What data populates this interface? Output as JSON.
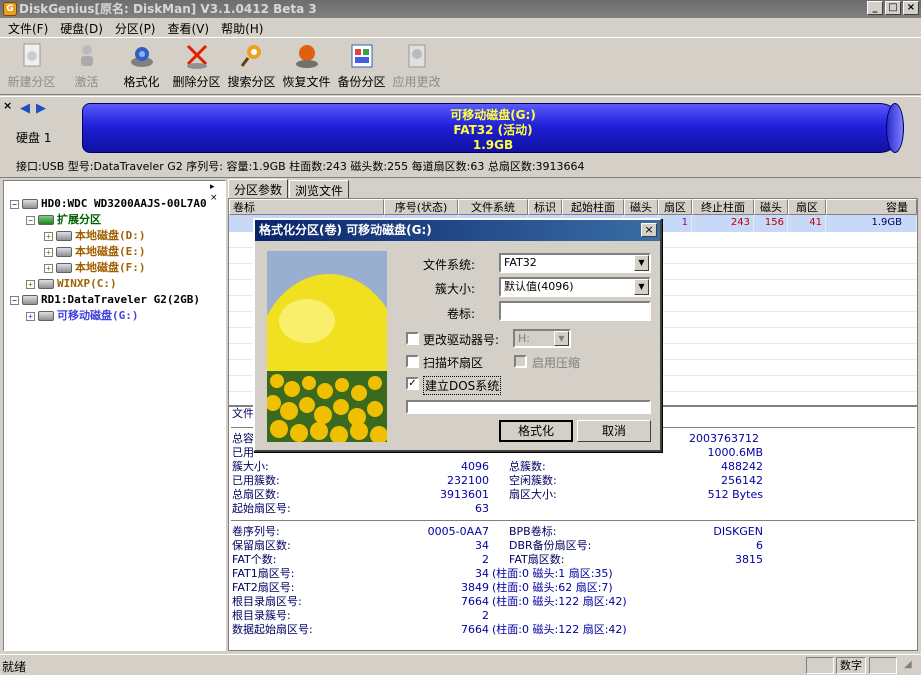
{
  "title": "DiskGenius[原名: DiskMan] V3.1.0412 Beta 3",
  "app_icon_letter": "G",
  "menu": [
    "文件(F)",
    "硬盘(D)",
    "分区(P)",
    "查看(V)",
    "帮助(H)"
  ],
  "toolbar": [
    {
      "label": "新建分区",
      "icon": "new-partition-icon",
      "enabled": false
    },
    {
      "label": "激活",
      "icon": "activate-icon",
      "enabled": false
    },
    {
      "label": "格式化",
      "icon": "format-icon",
      "enabled": true
    },
    {
      "label": "删除分区",
      "icon": "delete-icon",
      "enabled": true
    },
    {
      "label": "搜索分区",
      "icon": "search-icon",
      "enabled": true
    },
    {
      "label": "恢复文件",
      "icon": "recover-icon",
      "enabled": true
    },
    {
      "label": "备份分区",
      "icon": "backup-icon",
      "enabled": true
    },
    {
      "label": "应用更改",
      "icon": "apply-icon",
      "enabled": false
    }
  ],
  "disk_label": "硬盘 1",
  "partition_bar": {
    "name": "可移动磁盘(G:)",
    "fs": "FAT32 (活动)",
    "size": "1.9GB"
  },
  "disk_info": "接口:USB  型号:DataTraveler G2  序列号:  容量:1.9GB  柱面数:243  磁头数:255  每道扇区数:63  总扇区数:3913664",
  "tree": [
    {
      "label": "HD0:WDC WD3200AAJS-00L7A0",
      "color": "#000000"
    },
    {
      "label": "扩展分区",
      "color": "#006000"
    },
    {
      "label": "本地磁盘(D:)",
      "color": "#a06000"
    },
    {
      "label": "本地磁盘(E:)",
      "color": "#a06000"
    },
    {
      "label": "本地磁盘(F:)",
      "color": "#a06000"
    },
    {
      "label": "WINXP(C:)",
      "color": "#a06000"
    },
    {
      "label": "RD1:DataTraveler G2(2GB)",
      "color": "#000000"
    },
    {
      "label": "可移动磁盘(G:)",
      "color": "#4040e0"
    }
  ],
  "tabs": [
    "分区参数",
    "浏览文件"
  ],
  "grid_headers": [
    "卷标",
    "序号(状态)",
    "文件系统",
    "标识",
    "起始柱面",
    "磁头",
    "扇区",
    "终止柱面",
    "磁头",
    "扇区",
    "容量"
  ],
  "grid_row": [
    "",
    "",
    "",
    "",
    "",
    "",
    "1",
    "243",
    "156",
    "41",
    "1.9GB"
  ],
  "details": {
    "fs_label": "文件",
    "total_label": "总容",
    "used_label": "已用",
    "total_val": "2003763712",
    "free_val": "1000.6MB",
    "rows1": [
      {
        "l": "簇大小:",
        "v": "4096",
        "l2": "总簇数:",
        "v2": "488242"
      },
      {
        "l": "已用簇数:",
        "v": "232100",
        "l2": "空闲簇数:",
        "v2": "256142"
      },
      {
        "l": "总扇区数:",
        "v": "3913601",
        "l2": "扇区大小:",
        "v2": "512 Bytes"
      },
      {
        "l": "起始扇区号:",
        "v": "63",
        "l2": "",
        "v2": ""
      }
    ],
    "rows2": [
      {
        "l": "卷序列号:",
        "v": "0005-0AA7",
        "l2": "BPB卷标:",
        "v2": "DISKGEN"
      },
      {
        "l": "保留扇区数:",
        "v": "34",
        "l2": "DBR备份扇区号:",
        "v2": "6"
      },
      {
        "l": "FAT个数:",
        "v": "2",
        "l2": "FAT扇区数:",
        "v2": "3815"
      },
      {
        "l": "FAT1扇区号:",
        "v": "34",
        "extra": "(柱面:0 磁头:1 扇区:35)"
      },
      {
        "l": "FAT2扇区号:",
        "v": "3849",
        "extra": "(柱面:0 磁头:62 扇区:7)"
      },
      {
        "l": "根目录扇区号:",
        "v": "7664",
        "extra": "(柱面:0 磁头:122 扇区:42)"
      },
      {
        "l": "根目录簇号:",
        "v": "2",
        "extra": ""
      },
      {
        "l": "数据起始扇区号:",
        "v": "7664",
        "extra": "(柱面:0 磁头:122 扇区:42)"
      }
    ]
  },
  "status": {
    "text": "就绪",
    "num": "数字"
  },
  "dialog": {
    "title": "格式化分区(卷) 可移动磁盘(G:)",
    "fs_label": "文件系统:",
    "fs_value": "FAT32",
    "cluster_label": "簇大小:",
    "cluster_value": "默认值(4096)",
    "volume_label": "卷标:",
    "volume_value": "",
    "change_drive_label": "更改驱动器号:",
    "drive_value": "H:",
    "scan_label": "扫描坏扇区",
    "compress_label": "启用压缩",
    "dos_label": "建立DOS系统",
    "dos_checked": true,
    "progress": 0,
    "format_btn": "格式化",
    "cancel_btn": "取消"
  }
}
